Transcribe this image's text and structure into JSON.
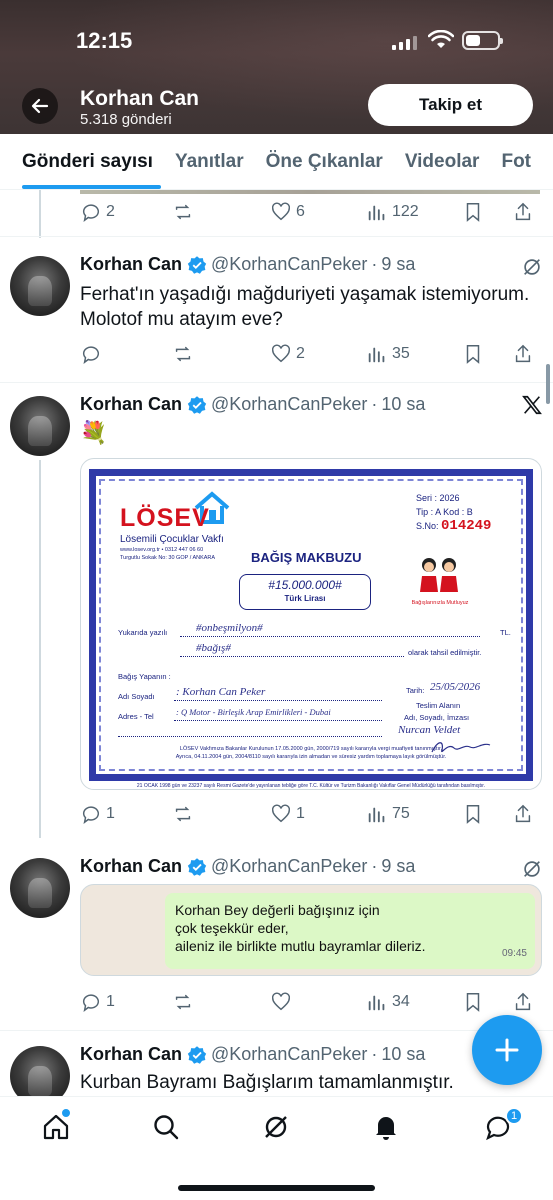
{
  "status_bar": {
    "time": "12:15"
  },
  "profile": {
    "name": "Korhan Can",
    "post_count": "5.318 gönderi",
    "follow_label": "Takip et"
  },
  "tabs": [
    {
      "label": "Gönderi sayısı",
      "active": true
    },
    {
      "label": "Yanıtlar"
    },
    {
      "label": "Öne Çıkanlar"
    },
    {
      "label": "Videolar"
    },
    {
      "label": "Fot"
    }
  ],
  "posts": [
    {
      "actions": {
        "replies": "2",
        "retweets": "",
        "likes": "6",
        "views": "122"
      }
    },
    {
      "name": "Korhan Can",
      "handle": "@KorhanCanPeker",
      "sep": "·",
      "time": "9 sa",
      "text": "Ferhat'ın yaşadığı mağduriyeti yaşamak istemiyorum. Molotof mu atayım eve?",
      "actions": {
        "replies": "",
        "retweets": "",
        "likes": "2",
        "views": "35"
      }
    },
    {
      "name": "Korhan Can",
      "handle": "@KorhanCanPeker",
      "sep": "·",
      "time": "10 sa",
      "text": "💐",
      "actions": {
        "replies": "1",
        "retweets": "",
        "likes": "1",
        "views": "75"
      }
    },
    {
      "name": "Korhan Can",
      "handle": "@KorhanCanPeker",
      "sep": "·",
      "time": "9 sa",
      "actions": {
        "replies": "1",
        "retweets": "",
        "likes": "",
        "views": "34"
      }
    },
    {
      "name": "Korhan Can",
      "handle": "@KorhanCanPeker",
      "sep": "·",
      "time": "10 sa",
      "text": "Kurban Bayramı Bağışlarım tamamlanmıştır."
    }
  ],
  "receipt": {
    "org_logo": "LÖSEV",
    "org_name": "Lösemili Çocuklar Vakfı",
    "web": "www.losev.org.tr • 0312 447 06 60",
    "address": "Turgutlu Sokak No: 30 GOP / ANKARA",
    "seri": "Seri : 2026",
    "tip": "Tip : A   Kod : B",
    "sno_label": "S.No:",
    "sno_value": "014249",
    "title": "BAĞIŞ MAKBUZU",
    "amount": "#15.000.000#",
    "currency": "Türk Lirası",
    "kids_caption": "Bağışlarınızla Mutluyuz",
    "yukarida_label": "Yukarıda yazılı",
    "yukarida_value": "#onbeşmilyon#",
    "tl": "TL.",
    "bagis_value": "#bağış#",
    "tahsil": "olarak tahsil edilmiştir.",
    "bagis_yapanin": "Bağış Yapanın :",
    "adi_soyadi_label": "Adı Soyadı",
    "adi_soyadi_value": ": Korhan Can Peker",
    "adres_label": "Adres - Tel",
    "adres_value": ": Q Motor - Birleşik Arap Emirlikleri - Dubai",
    "tarih_label": "Tarih:",
    "tarih_value": "25/05/2026",
    "teslim": "Teslim Alanın",
    "teslim2": "Adı, Soyadı, İmzası",
    "teslim_name": "Nurcan Veldet",
    "fine1": "LÖSEV Vakfımıza Bakanlar Kurulunun 17.05.2000 gün, 2000/719 sayılı kararıyla vergi muafiyeti tanınmıştır.",
    "fine2": "Ayrıca, 04.11.2004 gün, 2004/8110 sayılı kararıyla izin almadan ve süresiz yardım toplamaya layık görülmüştür.",
    "bottom": "21 OCAK 1998 gün ve 23237 sayılı Resmi Gazete'de yayınlanan tebliğe göre T.C. Kültür ve Turizm Bakanlığı Vakıflar Genel Müdürlüğü tarafından basılmıştır."
  },
  "whatsapp": {
    "line1": "Korhan Bey değerli bağışınız için",
    "line2": "çok teşekkür eder,",
    "line3": "aileniz ile birlikte mutlu bayramlar dileriz.",
    "time": "09:45"
  },
  "bottom_nav": {
    "messages_badge": "1"
  },
  "colors": {
    "accent": "#1d9bf0",
    "text": "#0f1419",
    "muted": "#536471"
  }
}
